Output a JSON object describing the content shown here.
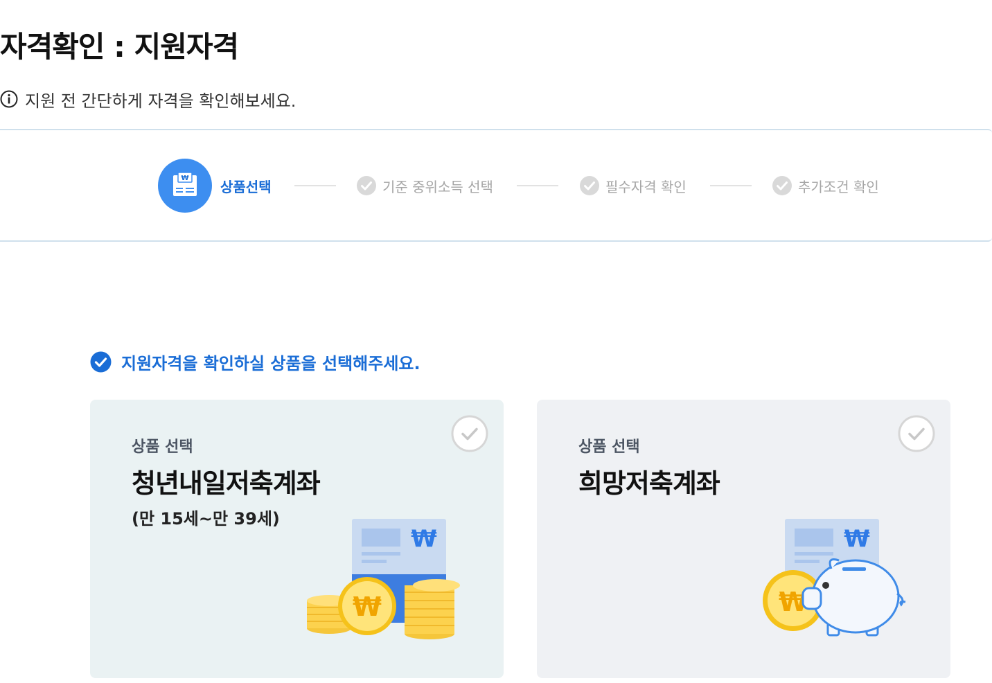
{
  "page": {
    "title": "자격확인 : 지원자격",
    "notice": "지원 전 간단하게 자격을 확인해보세요."
  },
  "stepper": {
    "steps": [
      {
        "label": "상품선택",
        "state": "active",
        "icon": "product-document-icon"
      },
      {
        "label": "기준 중위소득 선택",
        "state": "pending",
        "icon": "check-circle-icon"
      },
      {
        "label": "필수자격 확인",
        "state": "pending",
        "icon": "check-circle-icon"
      },
      {
        "label": "추가조건 확인",
        "state": "pending",
        "icon": "check-circle-icon"
      }
    ]
  },
  "instruction": {
    "text": "지원자격을 확인하실 상품을 선택해주세요.",
    "icon": "check-circle-filled-icon"
  },
  "products": [
    {
      "sub_label": "상품 선택",
      "name": "청년내일저축계좌",
      "age_range": "(만 15세~만 39세)",
      "illustration": "bankbook-coins-icon",
      "selected": false
    },
    {
      "sub_label": "상품 선택",
      "name": "희망저축계좌",
      "age_range": "",
      "illustration": "bankbook-piggybank-icon",
      "selected": false
    }
  ],
  "colors": {
    "accent_blue": "#1a6dd6",
    "step_icon_blue": "#3d8ef0",
    "muted_gray": "#a6a6a6",
    "card_youth_bg": "#eaf2f3",
    "card_hope_bg": "#eff1f4",
    "coin_yellow": "#fddb4d"
  },
  "symbols": {
    "won": "₩"
  }
}
